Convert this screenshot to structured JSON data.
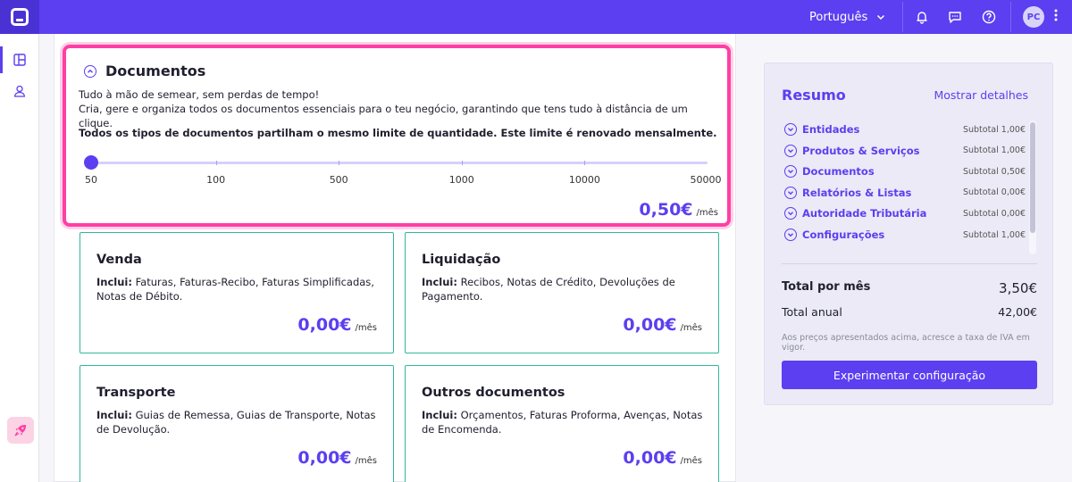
{
  "topbar": {
    "language": "Português",
    "avatar_initials": "PC",
    "icons": [
      "bell-icon",
      "chat-icon",
      "help-icon"
    ]
  },
  "sidebar": {
    "items": [
      {
        "icon": "layout-icon",
        "active": true
      },
      {
        "icon": "user-icon",
        "active": false
      }
    ],
    "bottom_icon": "rocket-icon"
  },
  "documentos": {
    "title": "Documentos",
    "desc_line1": "Tudo à mão de semear, sem perdas de tempo!",
    "desc_line2": "Cria, gere e organiza todos os documentos essenciais para o teu negócio, garantindo que tens tudo à distância de um clique.",
    "limit_note": "Todos os tipos de documentos partilham o mesmo limite de quantidade. Este limite é renovado mensalmente.",
    "slider": {
      "stops": [
        "50",
        "100",
        "500",
        "1000",
        "10000",
        "50000"
      ],
      "selected_index": 0
    },
    "price": "0,50€",
    "price_unit": "/mês"
  },
  "subcards": [
    {
      "title": "Venda",
      "incl_label": "Inclui:",
      "incl_text": " Faturas, Faturas-Recibo, Faturas Simplificadas, Notas de Débito.",
      "price": "0,00€",
      "unit": "/mês"
    },
    {
      "title": "Liquidação",
      "incl_label": "Inclui:",
      "incl_text": " Recibos, Notas de Crédito, Devoluções de Pagamento.",
      "price": "0,00€",
      "unit": "/mês"
    },
    {
      "title": "Transporte",
      "incl_label": "Inclui:",
      "incl_text": " Guias de Remessa, Guias de Transporte, Notas de Devolução.",
      "price": "0,00€",
      "unit": "/mês"
    },
    {
      "title": "Outros documentos",
      "incl_label": "Inclui:",
      "incl_text": " Orçamentos, Faturas Proforma, Avenças, Notas de Encomenda.",
      "price": "0,00€",
      "unit": "/mês"
    }
  ],
  "resumo": {
    "title": "Resumo",
    "details_link": "Mostrar detalhes",
    "items": [
      {
        "label": "Entidades",
        "subtotal": "Subtotal 1,00€"
      },
      {
        "label": "Produtos & Serviços",
        "subtotal": "Subtotal 1,00€"
      },
      {
        "label": "Documentos",
        "subtotal": "Subtotal 0,50€"
      },
      {
        "label": "Relatórios & Listas",
        "subtotal": "Subtotal 0,00€"
      },
      {
        "label": "Autoridade Tributária",
        "subtotal": "Subtotal 0,00€"
      },
      {
        "label": "Configurações",
        "subtotal": "Subtotal 1,00€"
      }
    ],
    "total_month_label": "Total por mês",
    "total_month_value": "3,50€",
    "total_year_label": "Total anual",
    "total_year_value": "42,00€",
    "note": "Aos preços apresentados acima, acresce a taxa de IVA em vigor.",
    "cta": "Experimentar configuração"
  },
  "colors": {
    "brand": "#5b3ff0",
    "highlight": "#ff3fa4",
    "card_border": "#2fb89a"
  }
}
